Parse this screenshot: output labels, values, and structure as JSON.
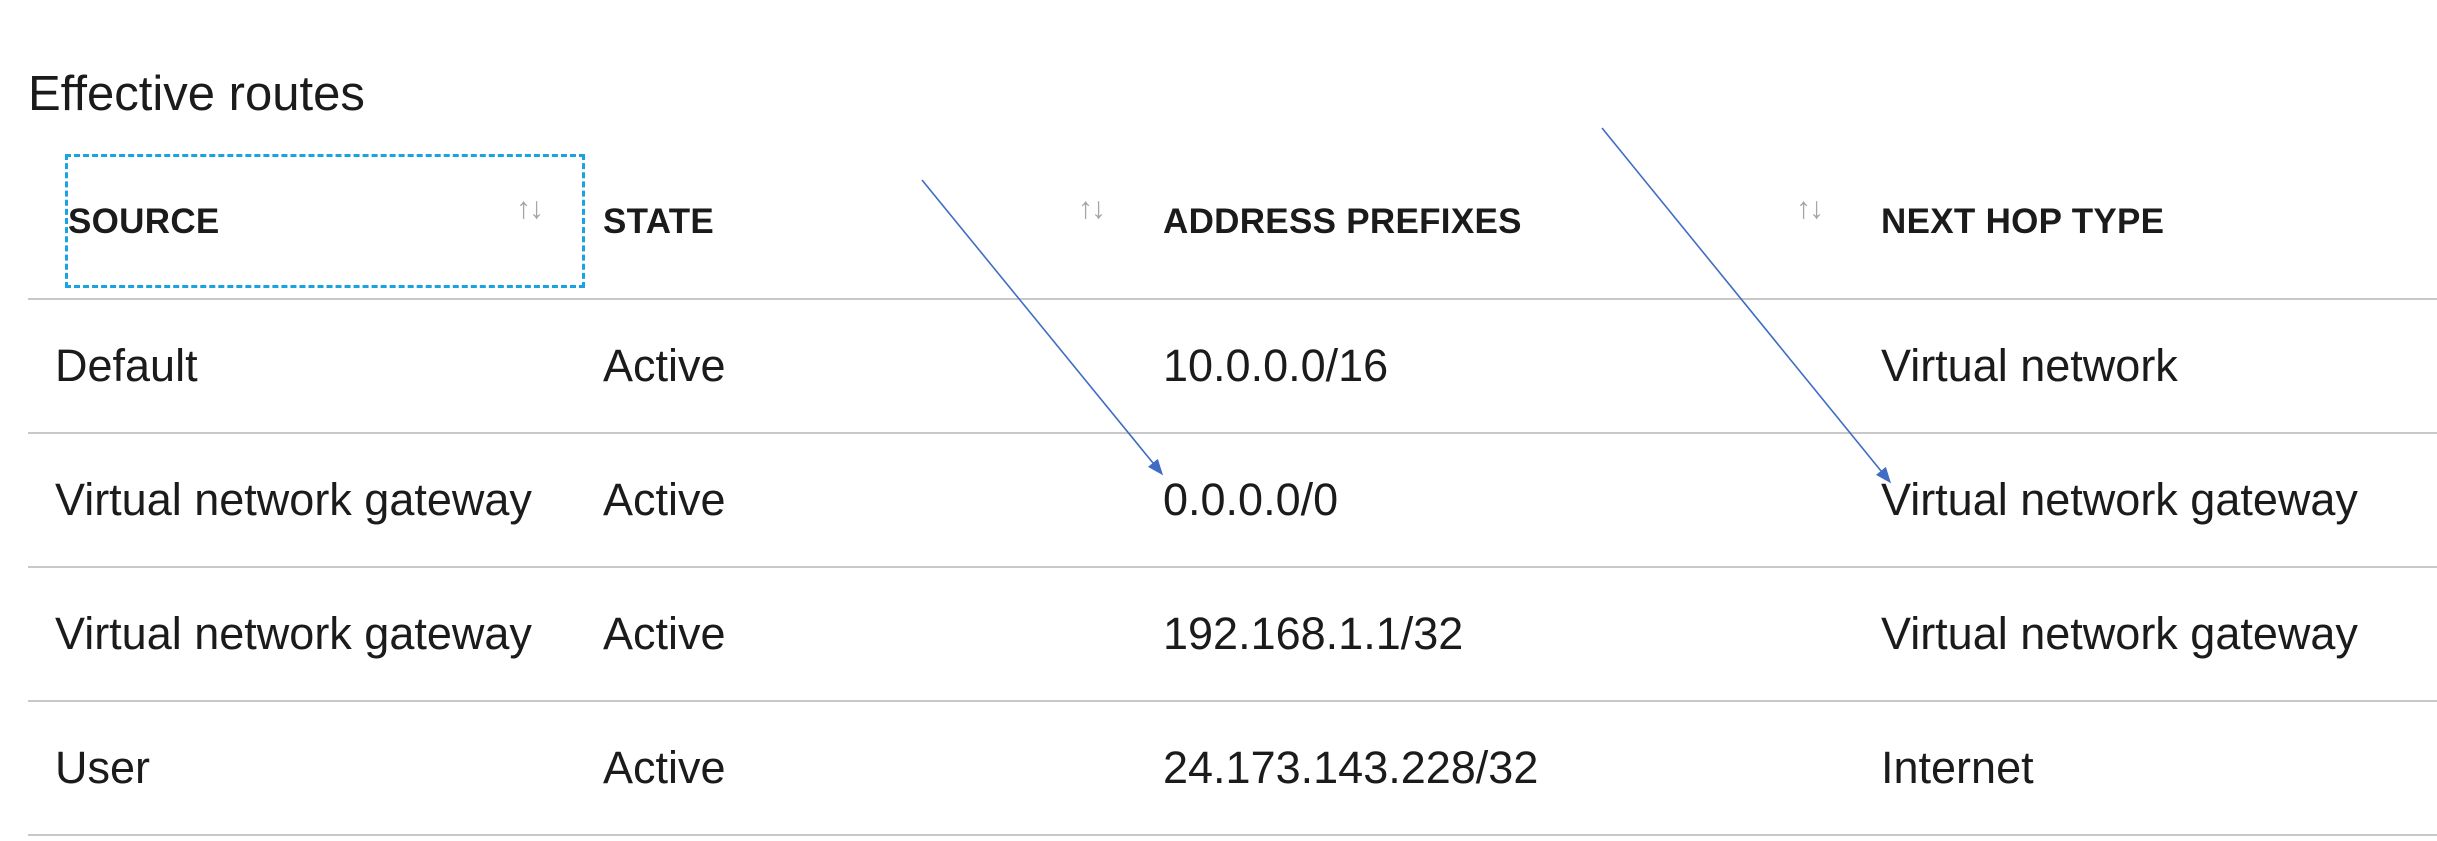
{
  "title": "Effective routes",
  "columns": [
    {
      "label": "SOURCE",
      "sort_icon": "↑↓"
    },
    {
      "label": "STATE",
      "sort_icon": "↑↓"
    },
    {
      "label": "ADDRESS PREFIXES",
      "sort_icon": "↑↓"
    },
    {
      "label": "NEXT HOP TYPE"
    }
  ],
  "rows": [
    {
      "source": "Default",
      "state": "Active",
      "address_prefix": "10.0.0.0/16",
      "next_hop_type": "Virtual network"
    },
    {
      "source": "Virtual network gateway",
      "state": "Active",
      "address_prefix": "0.0.0.0/0",
      "next_hop_type": "Virtual network gateway"
    },
    {
      "source": "Virtual network gateway",
      "state": "Active",
      "address_prefix": "192.168.1.1/32",
      "next_hop_type": "Virtual network gateway"
    },
    {
      "source": "User",
      "state": "Active",
      "address_prefix": "24.173.143.228/32",
      "next_hop_type": "Internet"
    }
  ],
  "colors": {
    "text": "#1b1b1b",
    "focus_outline": "#1aa3e0",
    "row_divider": "#c8c8c8",
    "sort_icon": "#a6a6a6",
    "annotation_arrow": "#3f6cc4"
  },
  "icons": {
    "sort": "sort-up-down-icon",
    "annotation": "annotation-arrow"
  }
}
